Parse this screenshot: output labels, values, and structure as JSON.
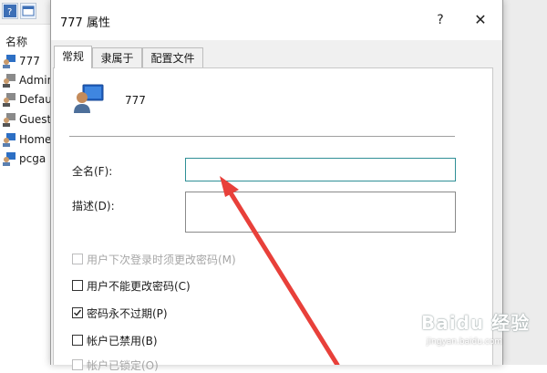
{
  "background": {
    "list_header": "名称",
    "users": [
      "777",
      "Admin",
      "Default",
      "Guest",
      "Home",
      "pcga"
    ]
  },
  "dialog": {
    "title": "777 属性",
    "help_label": "?",
    "close_label": "✕",
    "tabs": [
      {
        "label": "常规",
        "active": true
      },
      {
        "label": "隶属于",
        "active": false
      },
      {
        "label": "配置文件",
        "active": false
      }
    ],
    "user_name": "777",
    "fullname_label": "全名(F):",
    "fullname_value": "",
    "description_label": "描述(D):",
    "description_value": "",
    "checkboxes": [
      {
        "label": "用户下次登录时须更改密码(M)",
        "checked": false,
        "enabled": false
      },
      {
        "label": "用户不能更改密码(C)",
        "checked": false,
        "enabled": true
      },
      {
        "label": "密码永不过期(P)",
        "checked": true,
        "enabled": true
      },
      {
        "label": "帐户已禁用(B)",
        "checked": false,
        "enabled": true
      },
      {
        "label": "帐户已锁定(O)",
        "checked": false,
        "enabled": false
      }
    ]
  },
  "watermark": {
    "brand": "Baidu 经验",
    "url": "jingyan.baidu.com"
  },
  "colors": {
    "annotation_arrow": "#e8403a",
    "input_focus_border": "#2f8f96"
  }
}
